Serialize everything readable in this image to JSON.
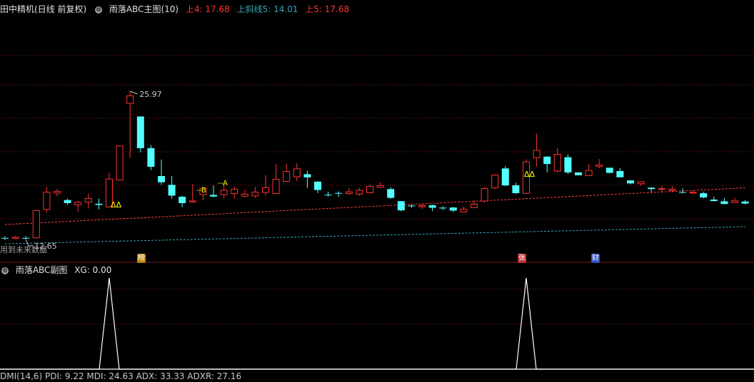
{
  "colors": {
    "up": "#ff3232",
    "down": "#54ffff",
    "grid": "#7a1c1c",
    "line_up": "#ff4040",
    "line_low": "#37a5b4",
    "signal": "#ffff00",
    "text": "#c8c8c8"
  },
  "main_header": {
    "stock": "田中精机(日线 前复权)",
    "indicator": "雨落ABC主图(10)",
    "upper4": "上4: 17.68",
    "slope5": "上斜线5: 14.01",
    "upper5": "上5: 17.68"
  },
  "sub_header": {
    "indicator": "雨落ABC副图",
    "xg": "XG: 0.00"
  },
  "bottom_header": {
    "text": "DMI(14,6)  PDI: 9.22  MDI: 24.63  ADX: 33.33  ADXR: 27.16"
  },
  "annotations": {
    "high": "25.97",
    "low": "12.65",
    "future_note": "用到未来数据",
    "label_b": "--B",
    "label_a": "--A",
    "signal_1": "ΔΔ",
    "signal_2": "ΔΔ"
  },
  "tags": [
    {
      "text": "榜",
      "color": "#b8860b"
    },
    {
      "text": "张",
      "color": "#c03030"
    },
    {
      "text": "财",
      "color": "#3050c0"
    }
  ],
  "chart_data": {
    "type": "candlestick",
    "candles": [
      [
        13.02,
        12.96,
        13.18,
        12.83
      ],
      [
        12.98,
        13.08,
        13.21,
        12.92
      ],
      [
        13.02,
        12.97,
        13.19,
        12.88
      ],
      [
        13.02,
        15.44,
        15.44,
        13.02
      ],
      [
        15.53,
        17.05,
        17.53,
        15.26
      ],
      [
        16.98,
        17.13,
        17.35,
        16.69
      ],
      [
        16.36,
        16.09,
        16.48,
        15.93
      ],
      [
        15.94,
        16.16,
        16.31,
        15.33
      ],
      [
        16.17,
        16.49,
        16.93,
        15.61
      ],
      [
        16.03,
        15.93,
        16.49,
        15.53
      ],
      [
        15.75,
        18.22,
        18.77,
        15.75
      ],
      [
        18.13,
        21.13,
        21.13,
        18.08
      ],
      [
        24.88,
        25.56,
        25.97,
        20.07
      ],
      [
        23.73,
        20.94,
        23.75,
        20.58
      ],
      [
        20.94,
        19.29,
        21.21,
        19.0
      ],
      [
        18.48,
        17.93,
        19.93,
        17.7
      ],
      [
        17.7,
        16.75,
        18.47,
        16.48
      ],
      [
        16.65,
        16.09,
        16.73,
        15.73
      ],
      [
        16.19,
        16.28,
        17.79,
        16.18
      ],
      [
        16.84,
        17.4,
        17.55,
        16.32
      ],
      [
        16.81,
        16.67,
        17.64,
        16.61
      ],
      [
        16.83,
        17.23,
        17.72,
        16.51
      ],
      [
        16.93,
        17.32,
        17.55,
        16.47
      ],
      [
        16.7,
        16.88,
        17.26,
        16.6
      ],
      [
        16.73,
        17.06,
        17.51,
        16.52
      ],
      [
        17.03,
        17.45,
        18.55,
        16.76
      ],
      [
        16.94,
        18.2,
        19.54,
        16.94
      ],
      [
        18.0,
        18.89,
        19.58,
        17.96
      ],
      [
        18.41,
        19.12,
        19.6,
        18.02
      ],
      [
        18.64,
        18.36,
        18.95,
        17.43
      ],
      [
        17.98,
        17.25,
        18.03,
        16.97
      ],
      [
        16.83,
        16.8,
        17.1,
        16.67
      ],
      [
        16.99,
        16.95,
        17.12,
        16.63
      ],
      [
        16.94,
        17.08,
        17.42,
        16.81
      ],
      [
        16.88,
        17.22,
        17.45,
        16.73
      ],
      [
        17.0,
        17.56,
        17.69,
        16.95
      ],
      [
        17.48,
        17.63,
        17.94,
        17.42
      ],
      [
        17.33,
        16.55,
        17.47,
        16.47
      ],
      [
        16.26,
        15.45,
        16.28,
        15.36
      ],
      [
        15.87,
        15.82,
        15.97,
        15.69
      ],
      [
        15.77,
        15.87,
        16.05,
        15.58
      ],
      [
        15.9,
        15.68,
        15.96,
        15.4
      ],
      [
        15.69,
        15.62,
        15.8,
        15.47
      ],
      [
        15.7,
        15.43,
        15.76,
        15.29
      ],
      [
        15.32,
        15.56,
        15.79,
        15.32
      ],
      [
        15.69,
        16.0,
        16.35,
        15.69
      ],
      [
        16.27,
        17.37,
        17.51,
        16.11
      ],
      [
        17.43,
        18.56,
        18.66,
        17.35
      ],
      [
        19.15,
        17.65,
        19.36,
        17.59
      ],
      [
        17.66,
        16.97,
        17.89,
        16.91
      ],
      [
        16.95,
        19.73,
        19.96,
        16.95
      ],
      [
        20.1,
        20.74,
        22.24,
        19.33
      ],
      [
        20.19,
        19.54,
        20.23,
        18.8
      ],
      [
        18.92,
        20.4,
        20.95,
        18.79
      ],
      [
        20.14,
        18.8,
        20.38,
        18.67
      ],
      [
        18.8,
        18.55,
        18.59,
        18.55
      ],
      [
        18.52,
        18.97,
        19.53,
        18.52
      ],
      [
        19.33,
        19.46,
        19.98,
        19.16
      ],
      [
        19.21,
        18.76,
        19.15,
        18.71
      ],
      [
        18.92,
        18.37,
        19.18,
        18.36
      ],
      [
        18.09,
        17.83,
        18.09,
        17.75
      ],
      [
        17.8,
        17.98,
        17.97,
        17.6
      ],
      [
        17.45,
        17.33,
        17.48,
        17.05
      ],
      [
        17.33,
        17.36,
        17.56,
        17.04
      ],
      [
        17.21,
        17.31,
        17.58,
        17.05
      ],
      [
        17.06,
        17.0,
        17.39,
        16.94
      ],
      [
        16.97,
        17.05,
        17.16,
        16.89
      ],
      [
        16.96,
        16.59,
        17.11,
        16.51
      ],
      [
        16.4,
        16.27,
        16.65,
        16.24
      ],
      [
        16.25,
        16.01,
        16.54,
        15.98
      ],
      [
        16.14,
        16.29,
        16.56,
        16.16
      ],
      [
        16.23,
        16.05,
        16.36,
        15.97
      ]
    ],
    "upper_trend_line": [
      14.2,
      17.44
    ],
    "lower_trend_line": [
      12.5,
      14.01
    ],
    "sub_signals": [
      {
        "x": 10,
        "value": 1
      },
      {
        "x": 50,
        "value": 1
      }
    ],
    "xg_range": [
      0,
      1
    ]
  }
}
